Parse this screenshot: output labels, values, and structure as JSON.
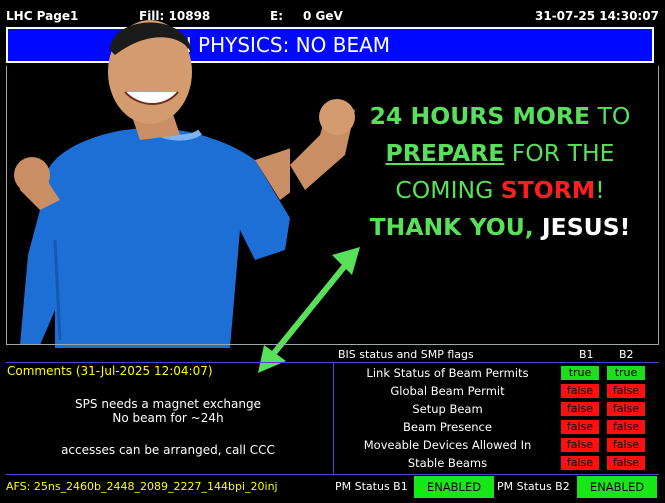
{
  "header": {
    "page": "LHC Page1",
    "fill": "Fill: 10898",
    "energy_label": "E:",
    "energy": "0 GeV",
    "timestamp": "31-07-25 14:30:07"
  },
  "banner": {
    "mode_text": "OTON PHYSICS: NO BEAM"
  },
  "meme": {
    "l1_bold": "24 HOURS MORE",
    "l1_rest": " TO",
    "l2_u": "PREPARE",
    "l2_rest": " FOR THE",
    "l3_a": "COMING ",
    "l3_storm": "STORM",
    "l3_b": "!",
    "l4_a": "THANK YOU, ",
    "l4_jesus": "JESUS!"
  },
  "comments": {
    "title": "Comments (31-Jul-2025 12:04:07)",
    "lines": [
      "SPS needs a magnet exchange",
      "No beam for ~24h",
      "accesses can be arranged, call CCC"
    ]
  },
  "bis": {
    "title": "BIS status and SMP flags",
    "b1": "B1",
    "b2": "B2",
    "rows": [
      {
        "label": "Link Status of Beam Permits",
        "b1": "true",
        "b2": "true"
      },
      {
        "label": "Global Beam Permit",
        "b1": "false",
        "b2": "false"
      },
      {
        "label": "Setup Beam",
        "b1": "false",
        "b2": "false"
      },
      {
        "label": "Beam Presence",
        "b1": "false",
        "b2": "false"
      },
      {
        "label": "Moveable Devices Allowed In",
        "b1": "false",
        "b2": "false"
      },
      {
        "label": "Stable Beams",
        "b1": "false",
        "b2": "false"
      }
    ]
  },
  "footer": {
    "afs": "AFS: 25ns_2460b_2448_2089_2227_144bpi_20inj",
    "pm_b1_label": "PM Status B1",
    "pm_b1": "ENABLED",
    "pm_b2_label": "PM Status B2",
    "pm_b2": "ENABLED"
  },
  "colors": {
    "banner_blue": "#0008ff",
    "comment_yellow": "#ffff00",
    "true_green": "#1fdc1f",
    "false_red": "#ff1010",
    "meme_green": "#59e05a",
    "storm_red": "#ff1d1d"
  }
}
